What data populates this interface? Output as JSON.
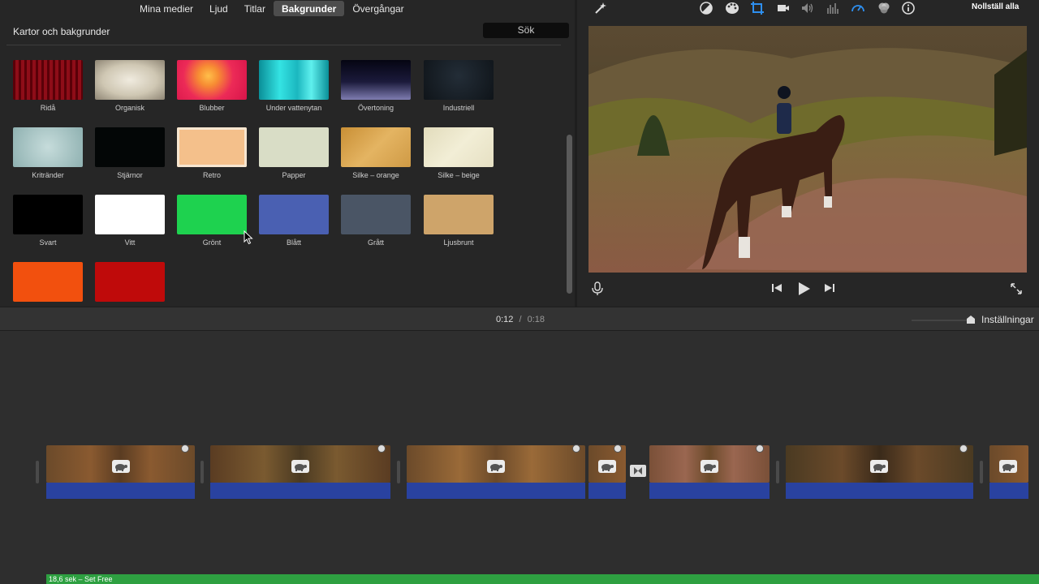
{
  "tabs": [
    "Mina medier",
    "Ljud",
    "Titlar",
    "Bakgrunder",
    "Övergångar"
  ],
  "active_tab": "Bakgrunder",
  "browser": {
    "header": "Kartor och bakgrunder",
    "search_label": "Sök",
    "items": [
      {
        "label": "Ridå",
        "color": "#7a0a12"
      },
      {
        "label": "Organisk",
        "color": "#d8d2c2"
      },
      {
        "label": "Blubber",
        "color": "#e8254e"
      },
      {
        "label": "Under vattenytan",
        "color": "#27c8cc"
      },
      {
        "label": "Övertoning",
        "color": "#1a1a3a"
      },
      {
        "label": "Industriell",
        "color": "#141a22"
      },
      {
        "label": "Kritränder",
        "color": "#a7c4c3"
      },
      {
        "label": "Stjärnor",
        "color": "#040808"
      },
      {
        "label": "Retro",
        "color": "#f2be86"
      },
      {
        "label": "Papper",
        "color": "#d8dcc5"
      },
      {
        "label": "Silke – orange",
        "color": "#d9a34d"
      },
      {
        "label": "Silke – beige",
        "color": "#ebe6c9"
      },
      {
        "label": "Svart",
        "color": "#000000"
      },
      {
        "label": "Vitt",
        "color": "#ffffff"
      },
      {
        "label": "Grönt",
        "color": "#1ed24f"
      },
      {
        "label": "Blått",
        "color": "#4a60b2"
      },
      {
        "label": "Grått",
        "color": "#4a5565"
      },
      {
        "label": "Ljusbrunt",
        "color": "#cea46a"
      },
      {
        "label": "",
        "color": "#f2500e"
      },
      {
        "label": "",
        "color": "#bf0a0a"
      }
    ]
  },
  "viewer": {
    "reset_label": "Nollställ alla",
    "tools": [
      "magic-wand",
      "color-balance",
      "color-palette",
      "crop",
      "stabilization",
      "volume",
      "equalizer",
      "speed",
      "filter",
      "info"
    ]
  },
  "timeline": {
    "current_time": "0:12",
    "separator": "/",
    "total_time": "0:18",
    "settings_label": "Inställningar",
    "music_label": "18,6 sek – Set Free"
  }
}
